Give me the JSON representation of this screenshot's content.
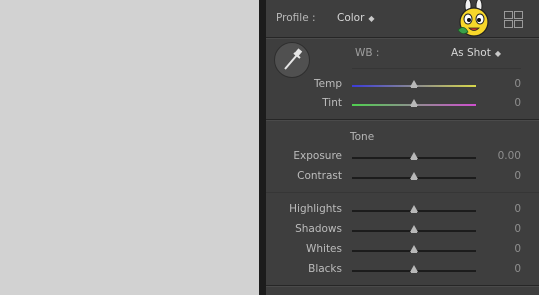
{
  "profile": {
    "label": "Profile :",
    "value": "Color"
  },
  "wb": {
    "label": "WB :",
    "value": "As Shot"
  },
  "sliders_wb": [
    {
      "label": "Temp",
      "value": "0",
      "position": 0.5
    },
    {
      "label": "Tint",
      "value": "0",
      "position": 0.5
    }
  ],
  "tone": {
    "heading": "Tone"
  },
  "sliders_tone": [
    {
      "label": "Exposure",
      "value": "0.00",
      "position": 0.5
    },
    {
      "label": "Contrast",
      "value": "0",
      "position": 0.5
    }
  ],
  "sliders_detail": [
    {
      "label": "Highlights",
      "value": "0",
      "position": 0.5
    },
    {
      "label": "Shadows",
      "value": "0",
      "position": 0.5
    },
    {
      "label": "Whites",
      "value": "0",
      "position": 0.5
    },
    {
      "label": "Blacks",
      "value": "0",
      "position": 0.5
    }
  ],
  "colors": {
    "panel_bg": "#3e3e3e",
    "temp_gradient_left": "#3b3bd9",
    "temp_gradient_right": "#d8d84a",
    "tint_gradient_left": "#4fcf4f",
    "tint_gradient_right": "#cf4fcf",
    "neutral_track": "#1c1c1c"
  }
}
